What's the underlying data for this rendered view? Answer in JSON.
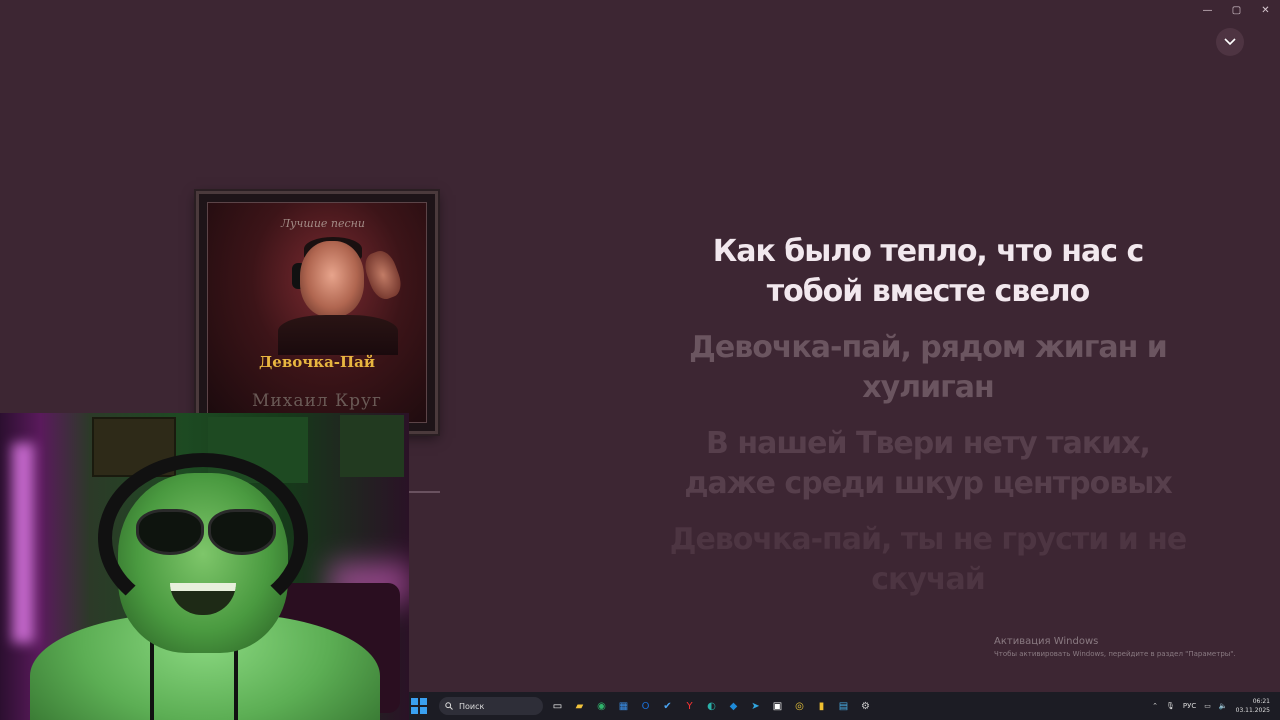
{
  "window": {
    "minimize_glyph": "—",
    "maximize_glyph": "▢",
    "close_glyph": "✕",
    "collapse_icon": "chevron-down-icon"
  },
  "album": {
    "script_text": "Лучшие песни",
    "title": "Девочка-Пай",
    "artist": "Михаил Круг"
  },
  "lyrics": {
    "active": [
      "Как было тепло, что нас с",
      "тобой вместе свело"
    ],
    "next1": [
      "Девочка-пай, рядом жиган и",
      "хулиган"
    ],
    "next2": [
      "В нашей Твери нету таких,",
      "даже среди шкур центровых"
    ],
    "next3": [
      "Девочка-пай, ты не грусти и не",
      "скучай"
    ]
  },
  "activation": {
    "title": "Активация Windows",
    "subtitle": "Чтобы активировать Windows, перейдите в раздел \"Параметры\"."
  },
  "taskbar": {
    "search_placeholder": "Поиск",
    "icons": [
      {
        "name": "task-view-icon",
        "glyph": "▭",
        "color": "#ffffff"
      },
      {
        "name": "file-explorer-icon",
        "glyph": "▰",
        "color": "#f2c33c"
      },
      {
        "name": "edge-icon",
        "glyph": "◉",
        "color": "#2fb36b"
      },
      {
        "name": "store-icon",
        "glyph": "▦",
        "color": "#3a8ee6"
      },
      {
        "name": "outlook-icon",
        "glyph": "O",
        "color": "#1a6fd6"
      },
      {
        "name": "todo-icon",
        "glyph": "✔",
        "color": "#4aa3f0"
      },
      {
        "name": "yandex-browser-icon",
        "glyph": "Y",
        "color": "#ff3333"
      },
      {
        "name": "app-icon-1",
        "glyph": "◐",
        "color": "#2ab0a8"
      },
      {
        "name": "app-icon-2",
        "glyph": "◆",
        "color": "#1e8ad8"
      },
      {
        "name": "telegram-icon",
        "glyph": "➤",
        "color": "#31a6e0"
      },
      {
        "name": "app-icon-3",
        "glyph": "▣",
        "color": "#ffffff"
      },
      {
        "name": "chrome-icon",
        "glyph": "◎",
        "color": "#e8c43a"
      },
      {
        "name": "app-icon-4",
        "glyph": "▮",
        "color": "#f0c030"
      },
      {
        "name": "app-icon-5",
        "glyph": "▤",
        "color": "#4ab0e8"
      },
      {
        "name": "settings-icon",
        "glyph": "⚙",
        "color": "#cccccc"
      }
    ],
    "tray_language": "РУС",
    "clock_time": "06:21",
    "clock_date": "03.11.2025"
  }
}
